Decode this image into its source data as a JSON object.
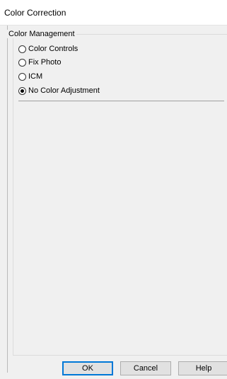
{
  "window": {
    "title": "Color Correction"
  },
  "color_management": {
    "legend": "Color Management",
    "options": [
      {
        "label": "Color Controls",
        "selected": false
      },
      {
        "label": "Fix Photo",
        "selected": false
      },
      {
        "label": "ICM",
        "selected": false
      },
      {
        "label": "No Color Adjustment",
        "selected": true
      }
    ]
  },
  "buttons": {
    "ok": "OK",
    "cancel": "Cancel",
    "help": "Help"
  },
  "colors": {
    "accent": "#0078d7",
    "dialog_bg": "#f0f0f0"
  }
}
